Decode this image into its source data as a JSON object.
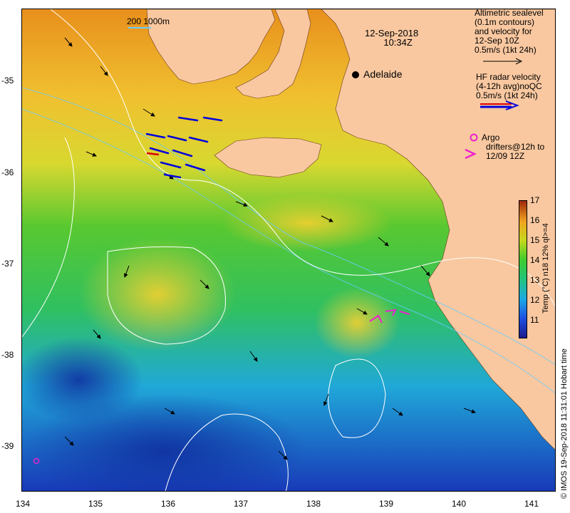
{
  "date_header": {
    "date": "12-Sep-2018",
    "time": "10:34Z"
  },
  "depth_legend": "200  1000m",
  "city": {
    "name": "Adelaide",
    "lon": 138.6,
    "lat": -35.0
  },
  "sealevel_legend": {
    "lines": [
      "Altimetric sealevel",
      "(0.1m contours)",
      "and velocity for",
      "12-Sep 10Z",
      "0.5m/s (1kt 24h)"
    ]
  },
  "hf_legend": {
    "lines": [
      "HF radar velocity",
      "(4-12h avg)noQC",
      "0.5m/s (1kt 24h)"
    ]
  },
  "argo_legend": {
    "lines": [
      "Argo",
      "drifters@12h to",
      "12/09 12Z"
    ]
  },
  "colorbar": {
    "title": "Temp (°C) n18 12% ql>=4",
    "ticks": [
      "17",
      "16",
      "15",
      "14",
      "13",
      "12",
      "11"
    ]
  },
  "credit": "© IMOS 19-Sep-2018 11:31:01 Hobart time",
  "axes": {
    "lon_ticks": [
      "134",
      "135",
      "136",
      "137",
      "138",
      "139",
      "140",
      "141"
    ],
    "lat_ticks": [
      "-35",
      "-36",
      "-37",
      "-38",
      "-39"
    ],
    "lon_range": [
      134,
      141.3
    ],
    "lat_range": [
      -39.55,
      -34.3
    ]
  },
  "colors": {
    "land": "#f9c8a0",
    "sealevel_contour": "#ffffff",
    "depth_contour": "#66ccff",
    "hf_vector": "#0000dd",
    "argo": "#ee22cc"
  }
}
